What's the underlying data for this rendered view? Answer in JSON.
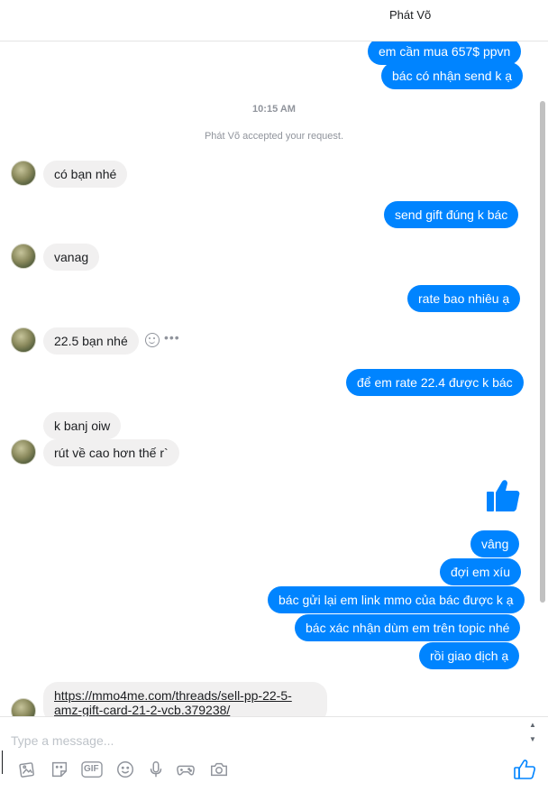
{
  "header": {
    "title": "Phát Võ"
  },
  "thread": {
    "time": "10:15 AM",
    "system_notice": "Phát Võ accepted your request.",
    "messages": [
      {
        "dir": "out",
        "text": "em cần mua 657$ ppvn"
      },
      {
        "dir": "out",
        "text": "bác có nhận send k ạ"
      },
      {
        "dir": "in",
        "text": "có bạn nhé"
      },
      {
        "dir": "out",
        "text": "send gift đúng k bác"
      },
      {
        "dir": "in",
        "text": "vanag"
      },
      {
        "dir": "out",
        "text": "rate bao nhiêu ạ"
      },
      {
        "dir": "in",
        "text": "22.5 bạn nhé"
      },
      {
        "dir": "out",
        "text": "để em rate 22.4 được k bác"
      },
      {
        "dir": "in",
        "text": "k banj oiw"
      },
      {
        "dir": "in",
        "text": "rút về cao hơn thế r`"
      },
      {
        "dir": "out",
        "type": "like-sticker",
        "text": ""
      },
      {
        "dir": "out",
        "text": "vâng"
      },
      {
        "dir": "out",
        "text": "đợi em xíu"
      },
      {
        "dir": "out",
        "text": "bác gửi lại em link mmo của bác được k ạ"
      },
      {
        "dir": "out",
        "text": "bác xác nhận dùm em trên topic nhé"
      },
      {
        "dir": "out",
        "text": "rồi giao dịch ạ"
      },
      {
        "dir": "in",
        "type": "link",
        "line1": "https://mmo4me.com/threads/sell-pp-22-5-",
        "line2": "amz-gift-card-21-2-vcb.379238/"
      }
    ]
  },
  "composer": {
    "placeholder": "Type a message...",
    "value": "",
    "tools": [
      "gallery-icon",
      "sticker-icon",
      "gif-icon",
      "emoji-icon",
      "microphone-icon",
      "game-controller-icon",
      "camera-icon"
    ],
    "gif_label": "GIF",
    "send_icon": "thumbs-up-icon"
  },
  "colors": {
    "accent": "#0084ff",
    "incoming_bubble": "#f1f0f0",
    "muted": "#90949c"
  }
}
